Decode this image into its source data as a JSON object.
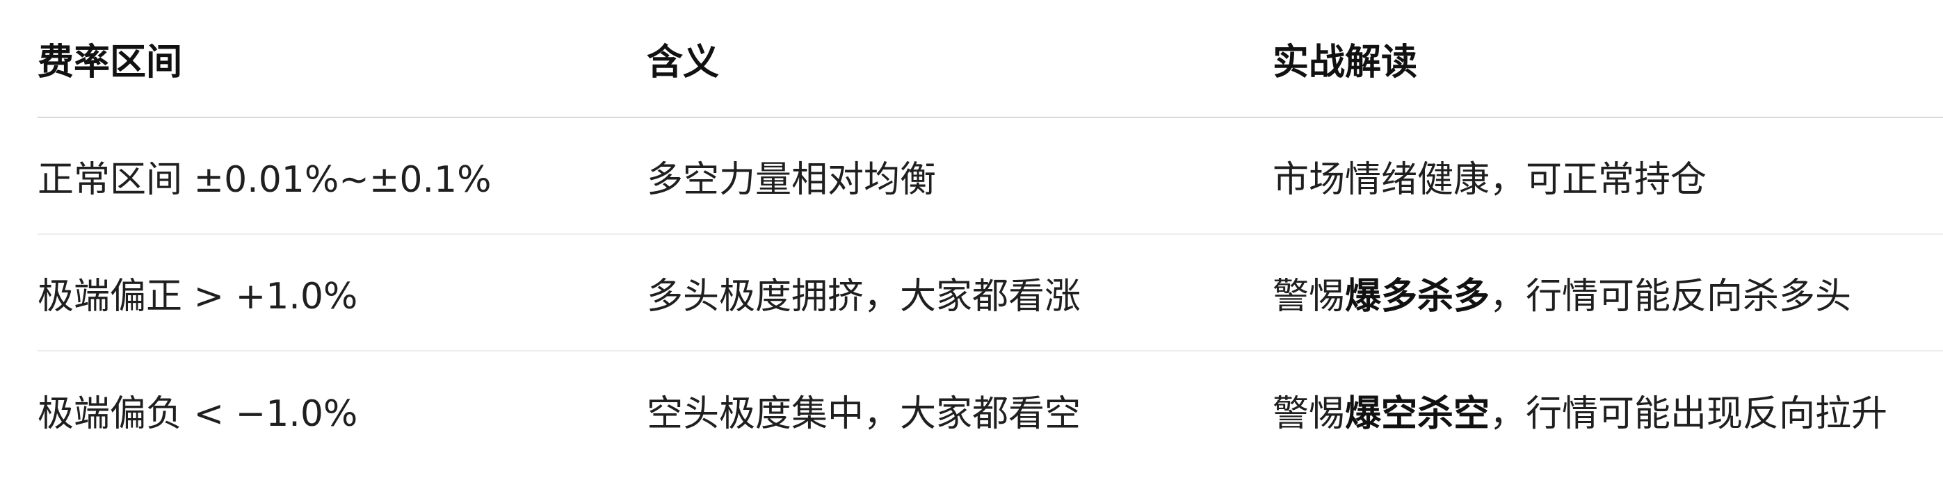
{
  "table": {
    "headers": [
      "费率区间",
      "含义",
      "实战解读"
    ],
    "rows": [
      {
        "range": "正常区间 ±0.01%~±0.1%",
        "meaning": "多空力量相对均衡",
        "interpretation": {
          "prefix": "市场情绪健康，可正常持仓",
          "emphasis": "",
          "suffix": ""
        }
      },
      {
        "range": "极端偏正 > +1.0%",
        "meaning": "多头极度拥挤，大家都看涨",
        "interpretation": {
          "prefix": "警惕",
          "emphasis": "爆多杀多",
          "suffix": "，行情可能反向杀多头"
        }
      },
      {
        "range": "极端偏负 < −1.0%",
        "meaning": "空头极度集中，大家都看空",
        "interpretation": {
          "prefix": "警惕",
          "emphasis": "爆空杀空",
          "suffix": "，行情可能出现反向拉升"
        }
      }
    ]
  }
}
